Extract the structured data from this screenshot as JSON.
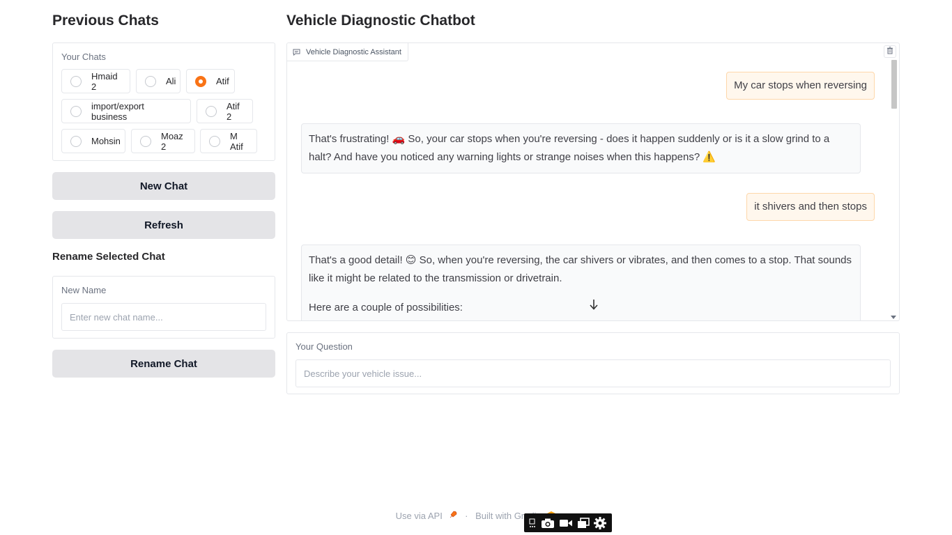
{
  "sidebar": {
    "title": "Previous Chats",
    "chats_label": "Your Chats",
    "chats": [
      {
        "label": "Hmaid 2",
        "selected": false
      },
      {
        "label": "Ali",
        "selected": false
      },
      {
        "label": "Atif",
        "selected": true
      },
      {
        "label": "import/export business",
        "selected": false
      },
      {
        "label": "Atif 2",
        "selected": false
      },
      {
        "label": "Mohsin",
        "selected": false
      },
      {
        "label": "Moaz 2",
        "selected": false
      },
      {
        "label": "M Atif",
        "selected": false
      }
    ],
    "new_chat_label": "New Chat",
    "refresh_label": "Refresh",
    "rename_heading": "Rename Selected Chat",
    "new_name_label": "New Name",
    "new_name_placeholder": "Enter new chat name...",
    "new_name_value": "",
    "rename_button_label": "Rename Chat"
  },
  "main": {
    "title": "Vehicle Diagnostic Chatbot",
    "chatbot_label": "Vehicle Diagnostic Assistant",
    "messages": [
      {
        "role": "user",
        "text": "My car stops when reversing"
      },
      {
        "role": "bot",
        "line1": "That's frustrating! 🚗 So, your car stops when you're reversing - does it happen suddenly or is it a slow grind to a",
        "line2": "halt? And have you noticed any warning lights or strange noises when this happens? ⚠️"
      },
      {
        "role": "user",
        "text": "it shivers and then stops"
      },
      {
        "role": "bot",
        "line1": "That's a good detail! 😊 So, when you're reversing, the car shivers or vibrates, and then comes to a stop. That sounds",
        "line2": "like it might be related to the transmission or drivetrain.",
        "line3": "Here are a couple of possibilities:"
      }
    ],
    "question_label": "Your Question",
    "question_placeholder": "Describe your vehicle issue...",
    "question_value": ""
  },
  "footer": {
    "api_label": "Use via API",
    "separator": "·",
    "built_with": "Built with Gradio"
  },
  "colors": {
    "accent": "#f97316",
    "user_bubble": "#fff7ed",
    "button_bg": "#e4e4e7"
  }
}
